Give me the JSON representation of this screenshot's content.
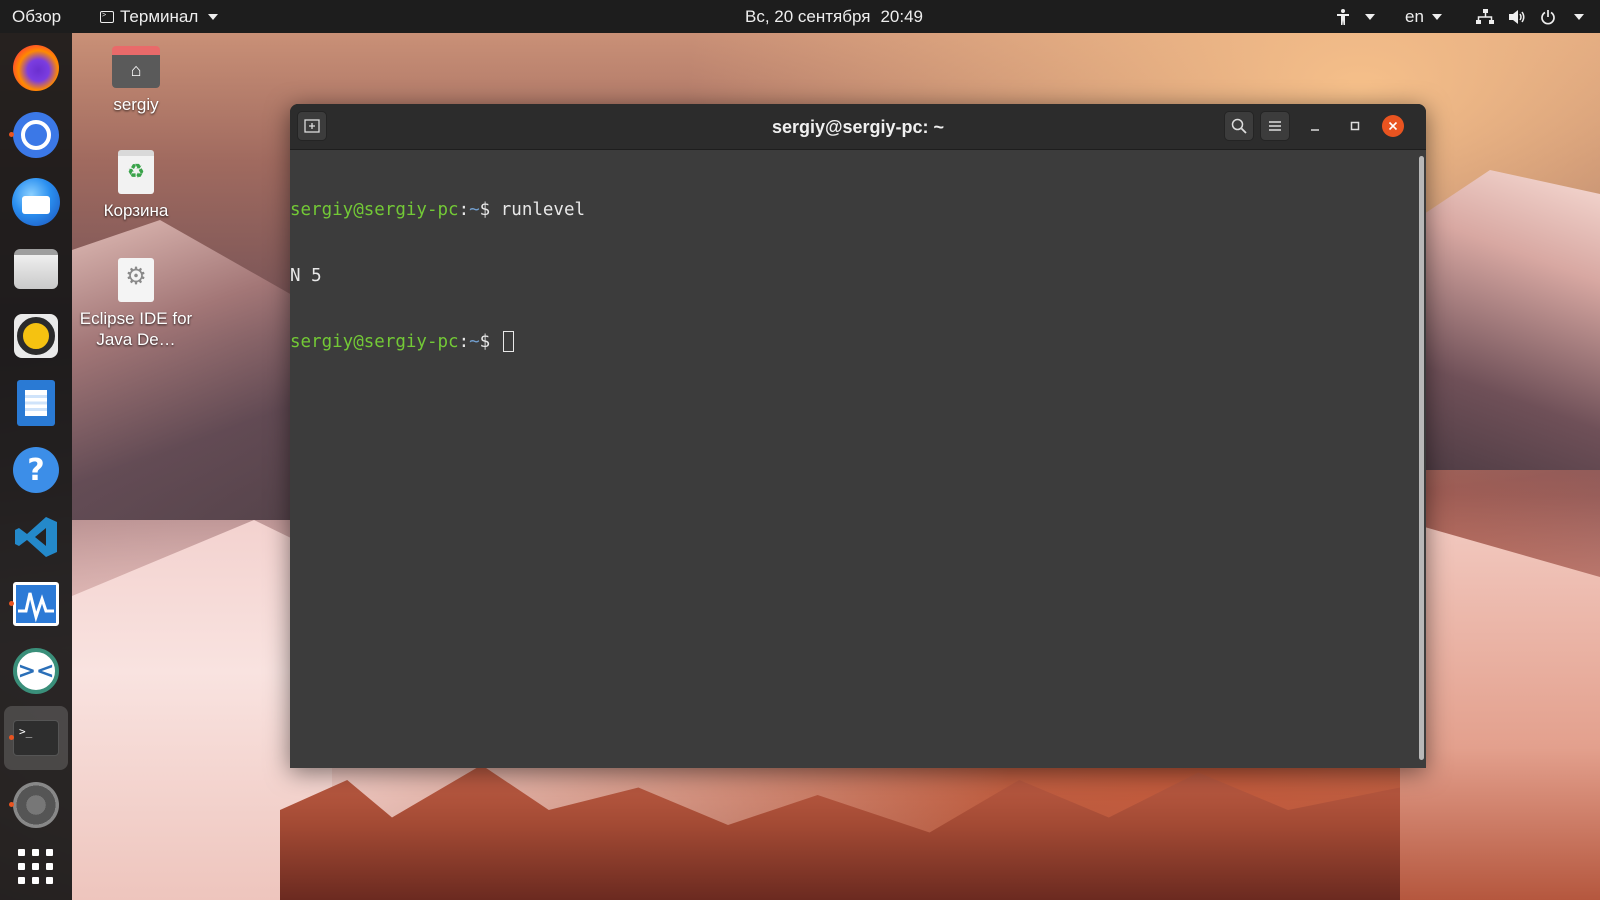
{
  "topbar": {
    "overview": "Обзор",
    "app_menu": "Терминал",
    "date": "Вс, 20 сентября",
    "time": "20:49",
    "language": "en"
  },
  "dock": {
    "apps": [
      "Firefox",
      "Chromium",
      "Thunderbird",
      "Files",
      "Rhythmbox",
      "LibreOffice Writer",
      "Help",
      "Visual Studio Code",
      "System Monitor",
      "Remmina",
      "Terminal",
      "Settings"
    ],
    "running": [
      "Chromium",
      "System Monitor",
      "Terminal",
      "Settings"
    ],
    "active": "Terminal"
  },
  "desktop": {
    "icons": [
      {
        "label": "sergiy",
        "icon": "home-folder-icon"
      },
      {
        "label": "Корзина",
        "icon": "trash-icon"
      },
      {
        "label": "Eclipse IDE for Java De…",
        "icon": "eclipse-icon"
      }
    ]
  },
  "terminal": {
    "title": "sergiy@sergiy-pc: ~",
    "lines": [
      {
        "user": "sergiy@sergiy-pc",
        "path": "~",
        "command": "runlevel"
      },
      {
        "output": "N 5"
      },
      {
        "user": "sergiy@sergiy-pc",
        "path": "~",
        "command": ""
      }
    ]
  },
  "colors": {
    "accent": "#e95420",
    "prompt_user": "#73c936",
    "prompt_path": "#729fcf",
    "terminal_bg": "#3c3c3c"
  }
}
